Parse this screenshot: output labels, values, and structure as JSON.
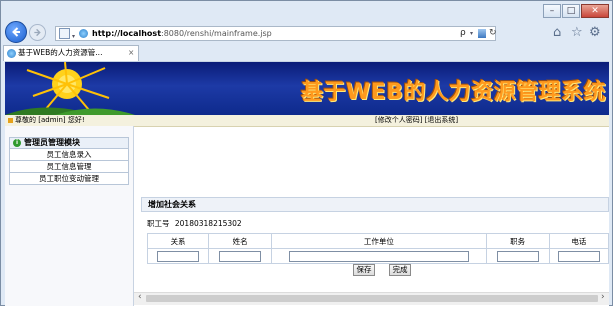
{
  "browser": {
    "url_host": "http://localhost",
    "url_rest": ":8080/renshi/mainframe.jsp",
    "tab_title": "基于WEB的人力资源管...",
    "tab_close": "×",
    "search_glyph": "ρ",
    "minimize": "–",
    "maximize": "□",
    "close": "✕"
  },
  "page": {
    "banner_title": "基于WEB的人力资源管理系统",
    "welcome_text": "尊敬的 [admin] 您好!",
    "top_links": "[修改个人密码] [退出系统]"
  },
  "sidebar": {
    "header": "管理员管理模块",
    "items": [
      {
        "label": "员工信息录入"
      },
      {
        "label": "员工信息管理"
      },
      {
        "label": "员工职位变动管理"
      }
    ]
  },
  "form": {
    "title": "增加社会关系",
    "employee_label": "职工号",
    "employee_id": "20180318215302",
    "columns": [
      "关系",
      "姓名",
      "工作单位",
      "职务",
      "电话"
    ],
    "save_label": "保存",
    "done_label": "完成"
  },
  "colors": {
    "banner_dark": "#0a1c78",
    "banner_title": "#ff9a1e",
    "back_button": "#2b6fd6"
  }
}
